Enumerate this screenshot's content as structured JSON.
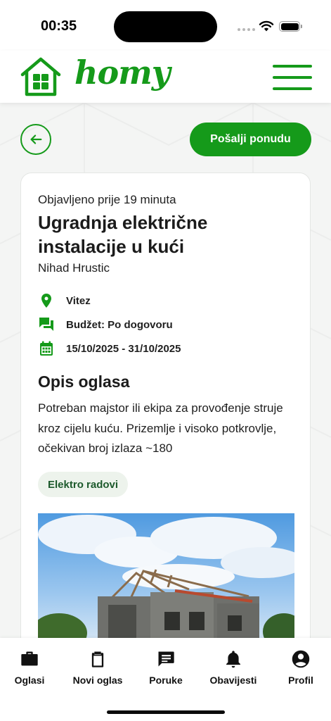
{
  "status_bar": {
    "time": "00:35"
  },
  "header": {
    "logo_text": "homy",
    "brand_color": "#159a1a",
    "menu_icon": "hamburger-menu-icon"
  },
  "actions": {
    "back_icon": "arrow-left-icon",
    "send_offer_label": "Pošalji ponudu"
  },
  "listing": {
    "posted": "Objavljeno prije 19 minuta",
    "title": "Ugradnja električne instalacije u kući",
    "client": "Nihad Hrustic",
    "location": "Vitez",
    "budget": "Budžet: Po dogovoru",
    "dates": "15/10/2025 - 31/10/2025",
    "description_heading": "Opis oglasa",
    "description": "Potreban majstor ili ekipa za provođenje struje kroz cijelu kuću. Prizemlje i visoko potkrovlje, očekivan broj izlaza ~180",
    "category": "Elektro radovi",
    "icons": {
      "location": "location-pin-icon",
      "budget": "chat-bubbles-icon",
      "dates": "calendar-icon"
    }
  },
  "bottom_nav": {
    "items": [
      {
        "label": "Oglasi",
        "icon": "briefcase-icon"
      },
      {
        "label": "Novi oglas",
        "icon": "clipboard-icon"
      },
      {
        "label": "Poruke",
        "icon": "message-icon"
      },
      {
        "label": "Obavijesti",
        "icon": "bell-icon"
      },
      {
        "label": "Profil",
        "icon": "account-circle-icon"
      }
    ]
  }
}
